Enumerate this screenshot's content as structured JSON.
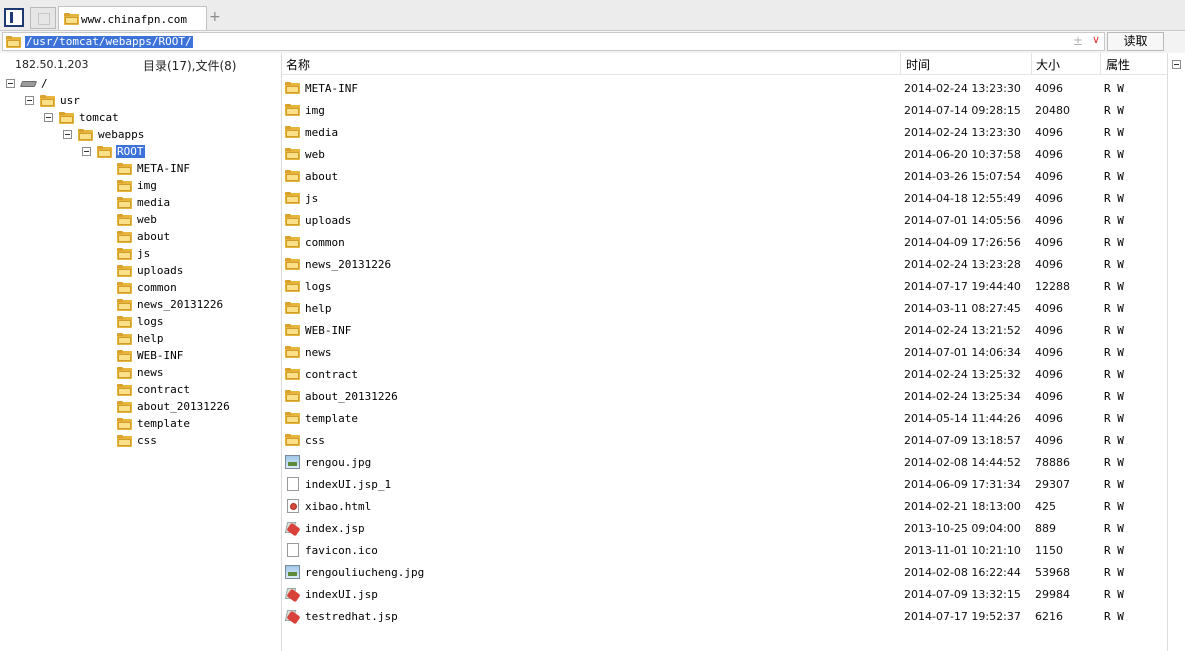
{
  "tab": {
    "title": "www.chinafpn.com",
    "new_tab": "+"
  },
  "address": {
    "path": "/usr/tomcat/webapps/ROOT/",
    "star": "±",
    "dropdown": "∨",
    "read_label": "读取"
  },
  "left_panel": {
    "server_ip": "182.50.1.203",
    "count_label": "目录(17),文件(8)",
    "tree": [
      {
        "label": "/",
        "kind": "drive"
      },
      {
        "label": "usr",
        "kind": "folder"
      },
      {
        "label": "tomcat",
        "kind": "folder"
      },
      {
        "label": "webapps",
        "kind": "folder"
      },
      {
        "label": "ROOT",
        "kind": "folder",
        "selected": true
      },
      {
        "label": "META-INF",
        "kind": "folder"
      },
      {
        "label": "img",
        "kind": "folder"
      },
      {
        "label": "media",
        "kind": "folder"
      },
      {
        "label": "web",
        "kind": "folder"
      },
      {
        "label": "about",
        "kind": "folder"
      },
      {
        "label": "js",
        "kind": "folder"
      },
      {
        "label": "uploads",
        "kind": "folder"
      },
      {
        "label": "common",
        "kind": "folder"
      },
      {
        "label": "news_20131226",
        "kind": "folder"
      },
      {
        "label": "logs",
        "kind": "folder"
      },
      {
        "label": "help",
        "kind": "folder"
      },
      {
        "label": "WEB-INF",
        "kind": "folder"
      },
      {
        "label": "news",
        "kind": "folder"
      },
      {
        "label": "contract",
        "kind": "folder"
      },
      {
        "label": "about_20131226",
        "kind": "folder"
      },
      {
        "label": "template",
        "kind": "folder"
      },
      {
        "label": "css",
        "kind": "folder"
      }
    ]
  },
  "columns": {
    "name": "名称",
    "time": "时间",
    "size": "大小",
    "attr": "属性"
  },
  "files": [
    {
      "name": "META-INF",
      "time": "2014-02-24 13:23:30",
      "size": "4096",
      "attr": "R W",
      "icon": "folder-icon"
    },
    {
      "name": "img",
      "time": "2014-07-14 09:28:15",
      "size": "20480",
      "attr": "R W",
      "icon": "folder-icon"
    },
    {
      "name": "media",
      "time": "2014-02-24 13:23:30",
      "size": "4096",
      "attr": "R W",
      "icon": "folder-icon"
    },
    {
      "name": "web",
      "time": "2014-06-20 10:37:58",
      "size": "4096",
      "attr": "R W",
      "icon": "folder-icon"
    },
    {
      "name": "about",
      "time": "2014-03-26 15:07:54",
      "size": "4096",
      "attr": "R W",
      "icon": "folder-icon"
    },
    {
      "name": "js",
      "time": "2014-04-18 12:55:49",
      "size": "4096",
      "attr": "R W",
      "icon": "folder-icon"
    },
    {
      "name": "uploads",
      "time": "2014-07-01 14:05:56",
      "size": "4096",
      "attr": "R W",
      "icon": "folder-icon"
    },
    {
      "name": "common",
      "time": "2014-04-09 17:26:56",
      "size": "4096",
      "attr": "R W",
      "icon": "folder-icon"
    },
    {
      "name": "news_20131226",
      "time": "2014-02-24 13:23:28",
      "size": "4096",
      "attr": "R W",
      "icon": "folder-icon"
    },
    {
      "name": "logs",
      "time": "2014-07-17 19:44:40",
      "size": "12288",
      "attr": "R W",
      "icon": "folder-icon"
    },
    {
      "name": "help",
      "time": "2014-03-11 08:27:45",
      "size": "4096",
      "attr": "R W",
      "icon": "folder-icon"
    },
    {
      "name": "WEB-INF",
      "time": "2014-02-24 13:21:52",
      "size": "4096",
      "attr": "R W",
      "icon": "folder-icon"
    },
    {
      "name": "news",
      "time": "2014-07-01 14:06:34",
      "size": "4096",
      "attr": "R W",
      "icon": "folder-icon"
    },
    {
      "name": "contract",
      "time": "2014-02-24 13:25:32",
      "size": "4096",
      "attr": "R W",
      "icon": "folder-icon"
    },
    {
      "name": "about_20131226",
      "time": "2014-02-24 13:25:34",
      "size": "4096",
      "attr": "R W",
      "icon": "folder-icon"
    },
    {
      "name": "template",
      "time": "2014-05-14 11:44:26",
      "size": "4096",
      "attr": "R W",
      "icon": "folder-icon"
    },
    {
      "name": "css",
      "time": "2014-07-09 13:18:57",
      "size": "4096",
      "attr": "R W",
      "icon": "folder-icon"
    },
    {
      "name": "rengou.jpg",
      "time": "2014-02-08 14:44:52",
      "size": "78886",
      "attr": "R W",
      "icon": "image-file-icon"
    },
    {
      "name": "indexUI.jsp_1",
      "time": "2014-06-09 17:31:34",
      "size": "29307",
      "attr": "R W",
      "icon": "document-file-icon"
    },
    {
      "name": "xibao.html",
      "time": "2014-02-21 18:13:00",
      "size": "425",
      "attr": "R W",
      "icon": "html-file-icon"
    },
    {
      "name": "index.jsp",
      "time": "2013-10-25 09:04:00",
      "size": "889",
      "attr": "R W",
      "icon": "jsp-file-icon"
    },
    {
      "name": "favicon.ico",
      "time": "2013-11-01 10:21:10",
      "size": "1150",
      "attr": "R W",
      "icon": "document-file-icon"
    },
    {
      "name": "rengouliucheng.jpg",
      "time": "2014-02-08 16:22:44",
      "size": "53968",
      "attr": "R W",
      "icon": "image-file-icon"
    },
    {
      "name": "indexUI.jsp",
      "time": "2014-07-09 13:32:15",
      "size": "29984",
      "attr": "R W",
      "icon": "jsp-file-icon"
    },
    {
      "name": "testredhat.jsp",
      "time": "2014-07-17 19:52:37",
      "size": "6216",
      "attr": "R W",
      "icon": "jsp-file-icon"
    }
  ],
  "colors": {
    "selection": "#3d73d9",
    "folder": "#e7b53b",
    "folder_light": "#fbe08a"
  }
}
